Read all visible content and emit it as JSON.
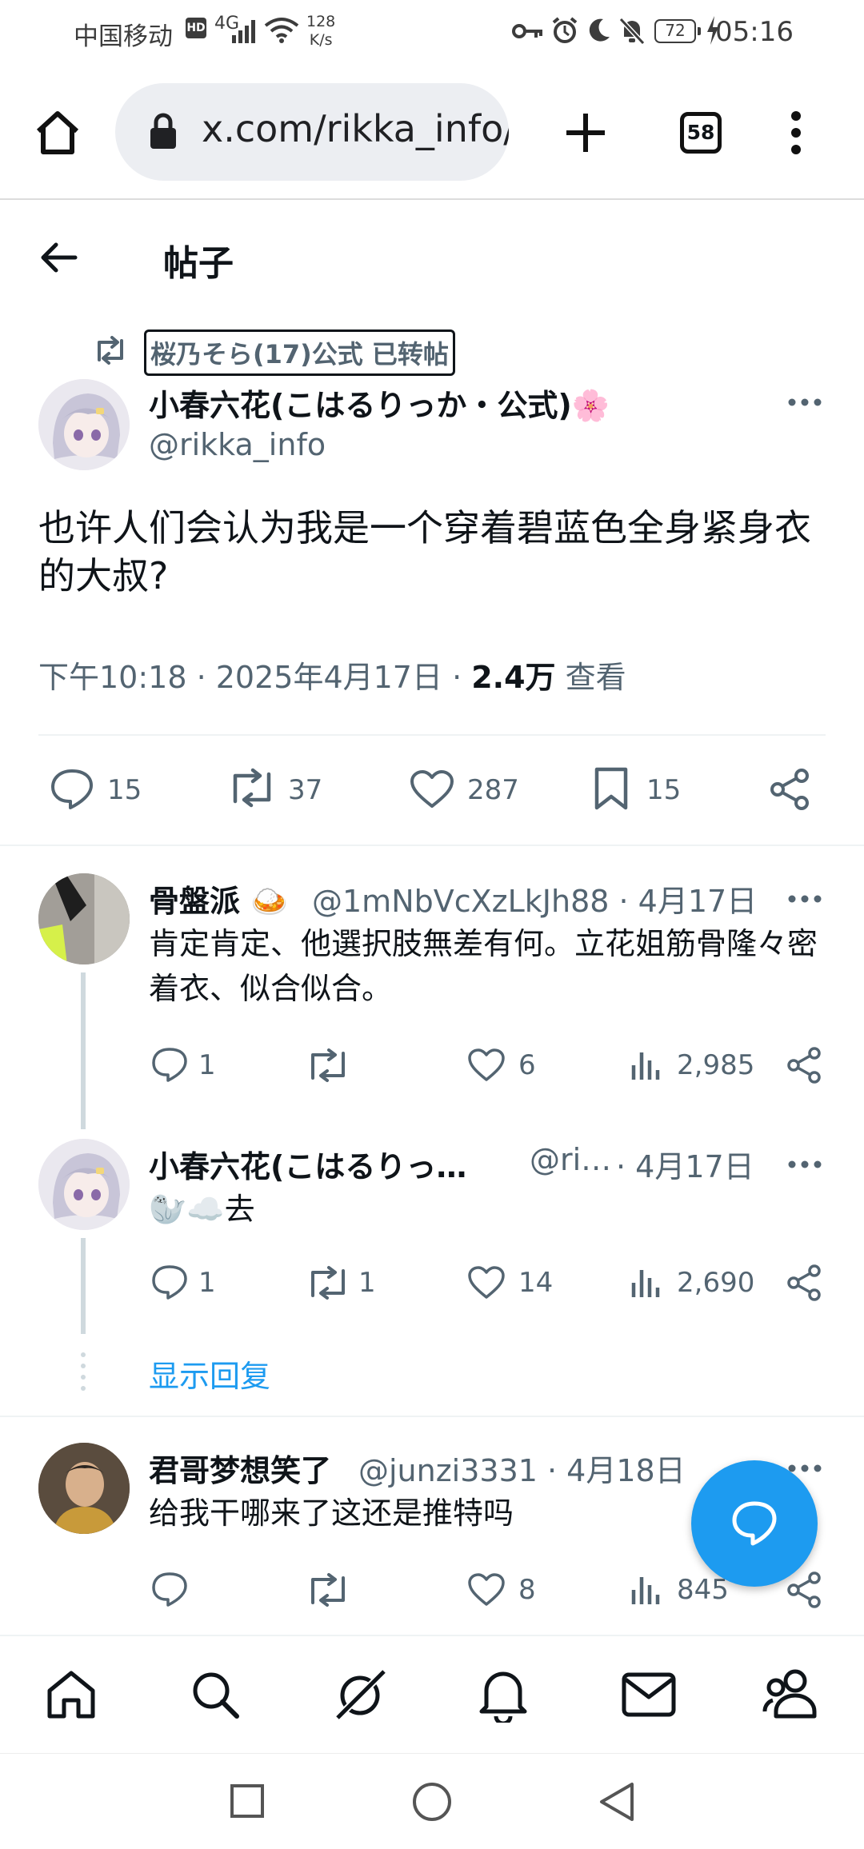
{
  "status_bar": {
    "carrier": "中国移动",
    "hd": "HD",
    "network": "4G",
    "speed_value": "128",
    "speed_unit": "K/s",
    "battery": "72",
    "time": "05:16"
  },
  "browser": {
    "url": "x.com/rikka_info/",
    "tab_count": "58"
  },
  "header": {
    "title": "帖子"
  },
  "main_tweet": {
    "retweeted_by": "桜乃そら(17)公式 已转帖",
    "author_name": "小春六花(こはるりっか・公式)🌸",
    "handle": "@rikka_info",
    "text": "也许人们会认为我是一个穿着碧蓝色全身紧身衣的大叔?",
    "time": "下午10:18 · 2025年4月17日 · ",
    "views_count": "2.4万",
    "views_label": " 查看",
    "replies": "15",
    "retweets": "37",
    "likes": "287",
    "bookmarks": "15"
  },
  "replies": [
    {
      "name": "骨盤派 🍛",
      "handle": "@1mNbVcXzLkJh88 · 4月17日",
      "text": "肯定肯定、他選択肢無差有何。立花姐筋骨隆々密着衣、似合似合。",
      "replies": "1",
      "retweets": "",
      "likes": "6",
      "views": "2,985"
    },
    {
      "name": "小春六花(こはるりっ…",
      "handle_short": "@ri…",
      "date": " · 4月17日",
      "text": "🦭☁️去",
      "replies": "1",
      "retweets": "1",
      "likes": "14",
      "views": "2,690"
    },
    {
      "name": "君哥梦想笑了",
      "handle": "@junzi3331 · 4月18日",
      "text": "给我干哪来了这还是推特吗",
      "replies": "",
      "retweets": "",
      "likes": "8",
      "views": "845"
    }
  ],
  "show_replies": "显示回复",
  "colors": {
    "accent": "#1d9bf0",
    "secondary_text": "#536471",
    "primary_text": "#0f1419"
  }
}
